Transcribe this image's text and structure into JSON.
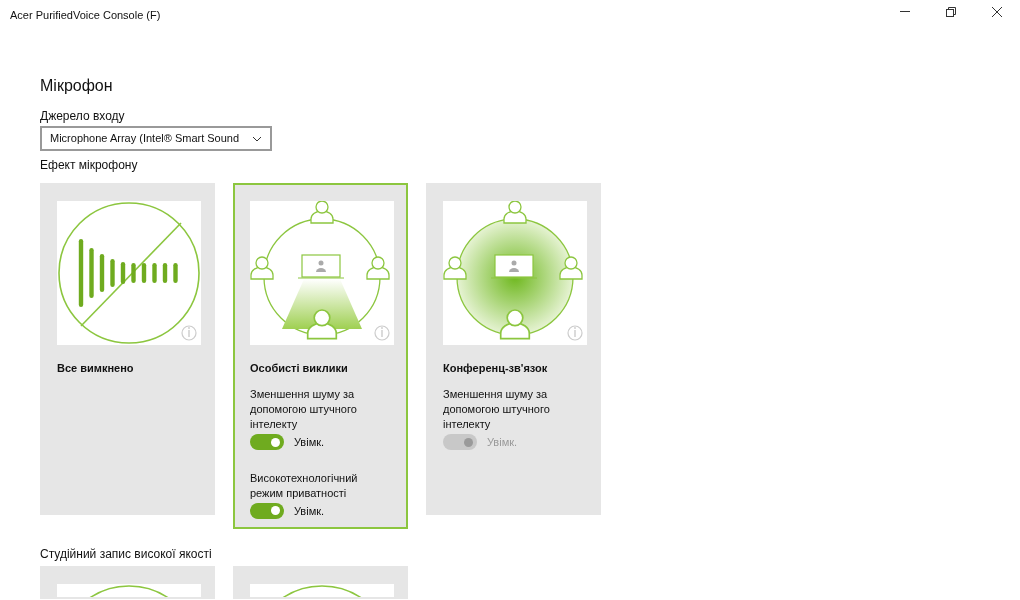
{
  "window": {
    "title": "Acer PurifiedVoice Console (F)"
  },
  "heading": "Мікрофон",
  "input_source": {
    "label": "Джерело входу",
    "value": "Microphone Array (Intel® Smart Sound"
  },
  "effects_section": {
    "title": "Ефект мікрофону",
    "cards": [
      {
        "kind": "off",
        "title": "Все вимкнено",
        "selected": false
      },
      {
        "kind": "personal",
        "title": "Особисті виклики",
        "selected": true,
        "options": [
          {
            "label": "Зменшення шуму за допомогою штучного інтелекту",
            "toggle_label": "Увімк.",
            "on": true,
            "disabled": false
          },
          {
            "label": "Високотехнологічний режим приватності",
            "toggle_label": "Увімк.",
            "on": true,
            "disabled": false
          }
        ]
      },
      {
        "kind": "conference",
        "title": "Конференц-зв'язок",
        "selected": false,
        "options": [
          {
            "label": "Зменшення шуму за допомогою штучного інтелекту",
            "toggle_label": "Увімк.",
            "on": true,
            "disabled": true
          }
        ]
      }
    ]
  },
  "studio_section": {
    "title": "Студійний запис високої якості",
    "cards": [
      {
        "kind": "studio",
        "selected": false
      },
      {
        "kind": "studio",
        "selected": false
      }
    ]
  }
}
